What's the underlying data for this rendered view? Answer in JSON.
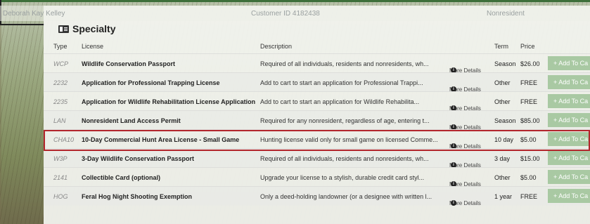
{
  "customer": {
    "name": "Deborah Kay Kelley",
    "id": "Customer ID 4182438",
    "status": "Nonresident"
  },
  "section": {
    "title": "Specialty",
    "icon": "id-card-icon"
  },
  "columns": [
    "Type",
    "License",
    "Description",
    "Term",
    "Price"
  ],
  "more_details_label": "More Details",
  "cart_label": "+ Add To Ca",
  "rows": [
    {
      "type": "WCP",
      "license": "Wildlife Conservation Passport",
      "description": "Required of all individuals, residents and nonresidents, wh...",
      "term": "Season",
      "price": "$26.00"
    },
    {
      "type": "2232",
      "license": "Application for Professional Trapping License",
      "description": "Add to cart to start an application for Professional Trappi...",
      "term": "Other",
      "price": "FREE"
    },
    {
      "type": "2235",
      "license": "Application for Wildlife Rehabilitation License Application",
      "description": "Add to cart to start an application for Wildlife Rehabilita...",
      "term": "Other",
      "price": "FREE"
    },
    {
      "type": "LAN",
      "license": "Nonresident Land Access Permit",
      "description": "Required for any nonresident, regardless of age, entering t...",
      "term": "Season",
      "price": "$85.00"
    },
    {
      "type": "CHA10",
      "license": "10-Day Commercial Hunt Area License - Small Game",
      "description": "Hunting license valid only for small game on licensed Comme...",
      "term": "10 day",
      "price": "$5.00"
    },
    {
      "type": "W3P",
      "license": "3-Day Wildlife Conservation Passport",
      "description": "Required of all individuals, residents and nonresidents, wh...",
      "term": "3 day",
      "price": "$15.00"
    },
    {
      "type": "2141",
      "license": "Collectible Card (optional)",
      "description": "Upgrade your license to a stylish, durable credit card styl...",
      "term": "Other",
      "price": "$5.00"
    },
    {
      "type": "HOG",
      "license": "Feral Hog Night Shooting Exemption",
      "description": "Only a deed-holding landowner (or a designee with written l...",
      "term": "1 year",
      "price": "FREE"
    }
  ],
  "colors": {
    "highlight": "#b3262d",
    "cart_button": "#a9c9a3",
    "accent_line": "#3d6f3a"
  }
}
